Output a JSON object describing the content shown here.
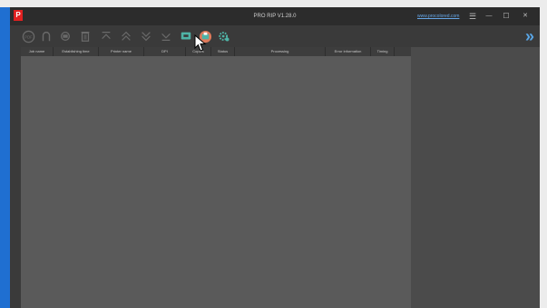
{
  "window": {
    "title": "PRO RIP V1.28.0",
    "website": "www.procolored.com",
    "logo_letter": "P",
    "controls": [
      "☰",
      "—",
      "☐",
      "✕"
    ]
  },
  "toolbar": {
    "icons": [
      "pdf-export-icon",
      "magnet-icon",
      "print-icon",
      "delete-icon",
      "move-top-icon",
      "move-up-icon",
      "move-down-icon",
      "move-bottom-icon",
      "preview-icon",
      "printer-settings-icon",
      "settings-icon"
    ],
    "expand_label": "»"
  },
  "table": {
    "columns": [
      "Job name",
      "Establishing time",
      "Printer name",
      "DPI",
      "Copies",
      "Status",
      "Processing",
      "Error information",
      "Timing"
    ]
  },
  "colors": {
    "accent": "#4fb3a6",
    "link": "#66a6e6",
    "logo": "#e02020",
    "titlebar": "#2c2c2c",
    "table_bg": "#5a5a5a"
  }
}
